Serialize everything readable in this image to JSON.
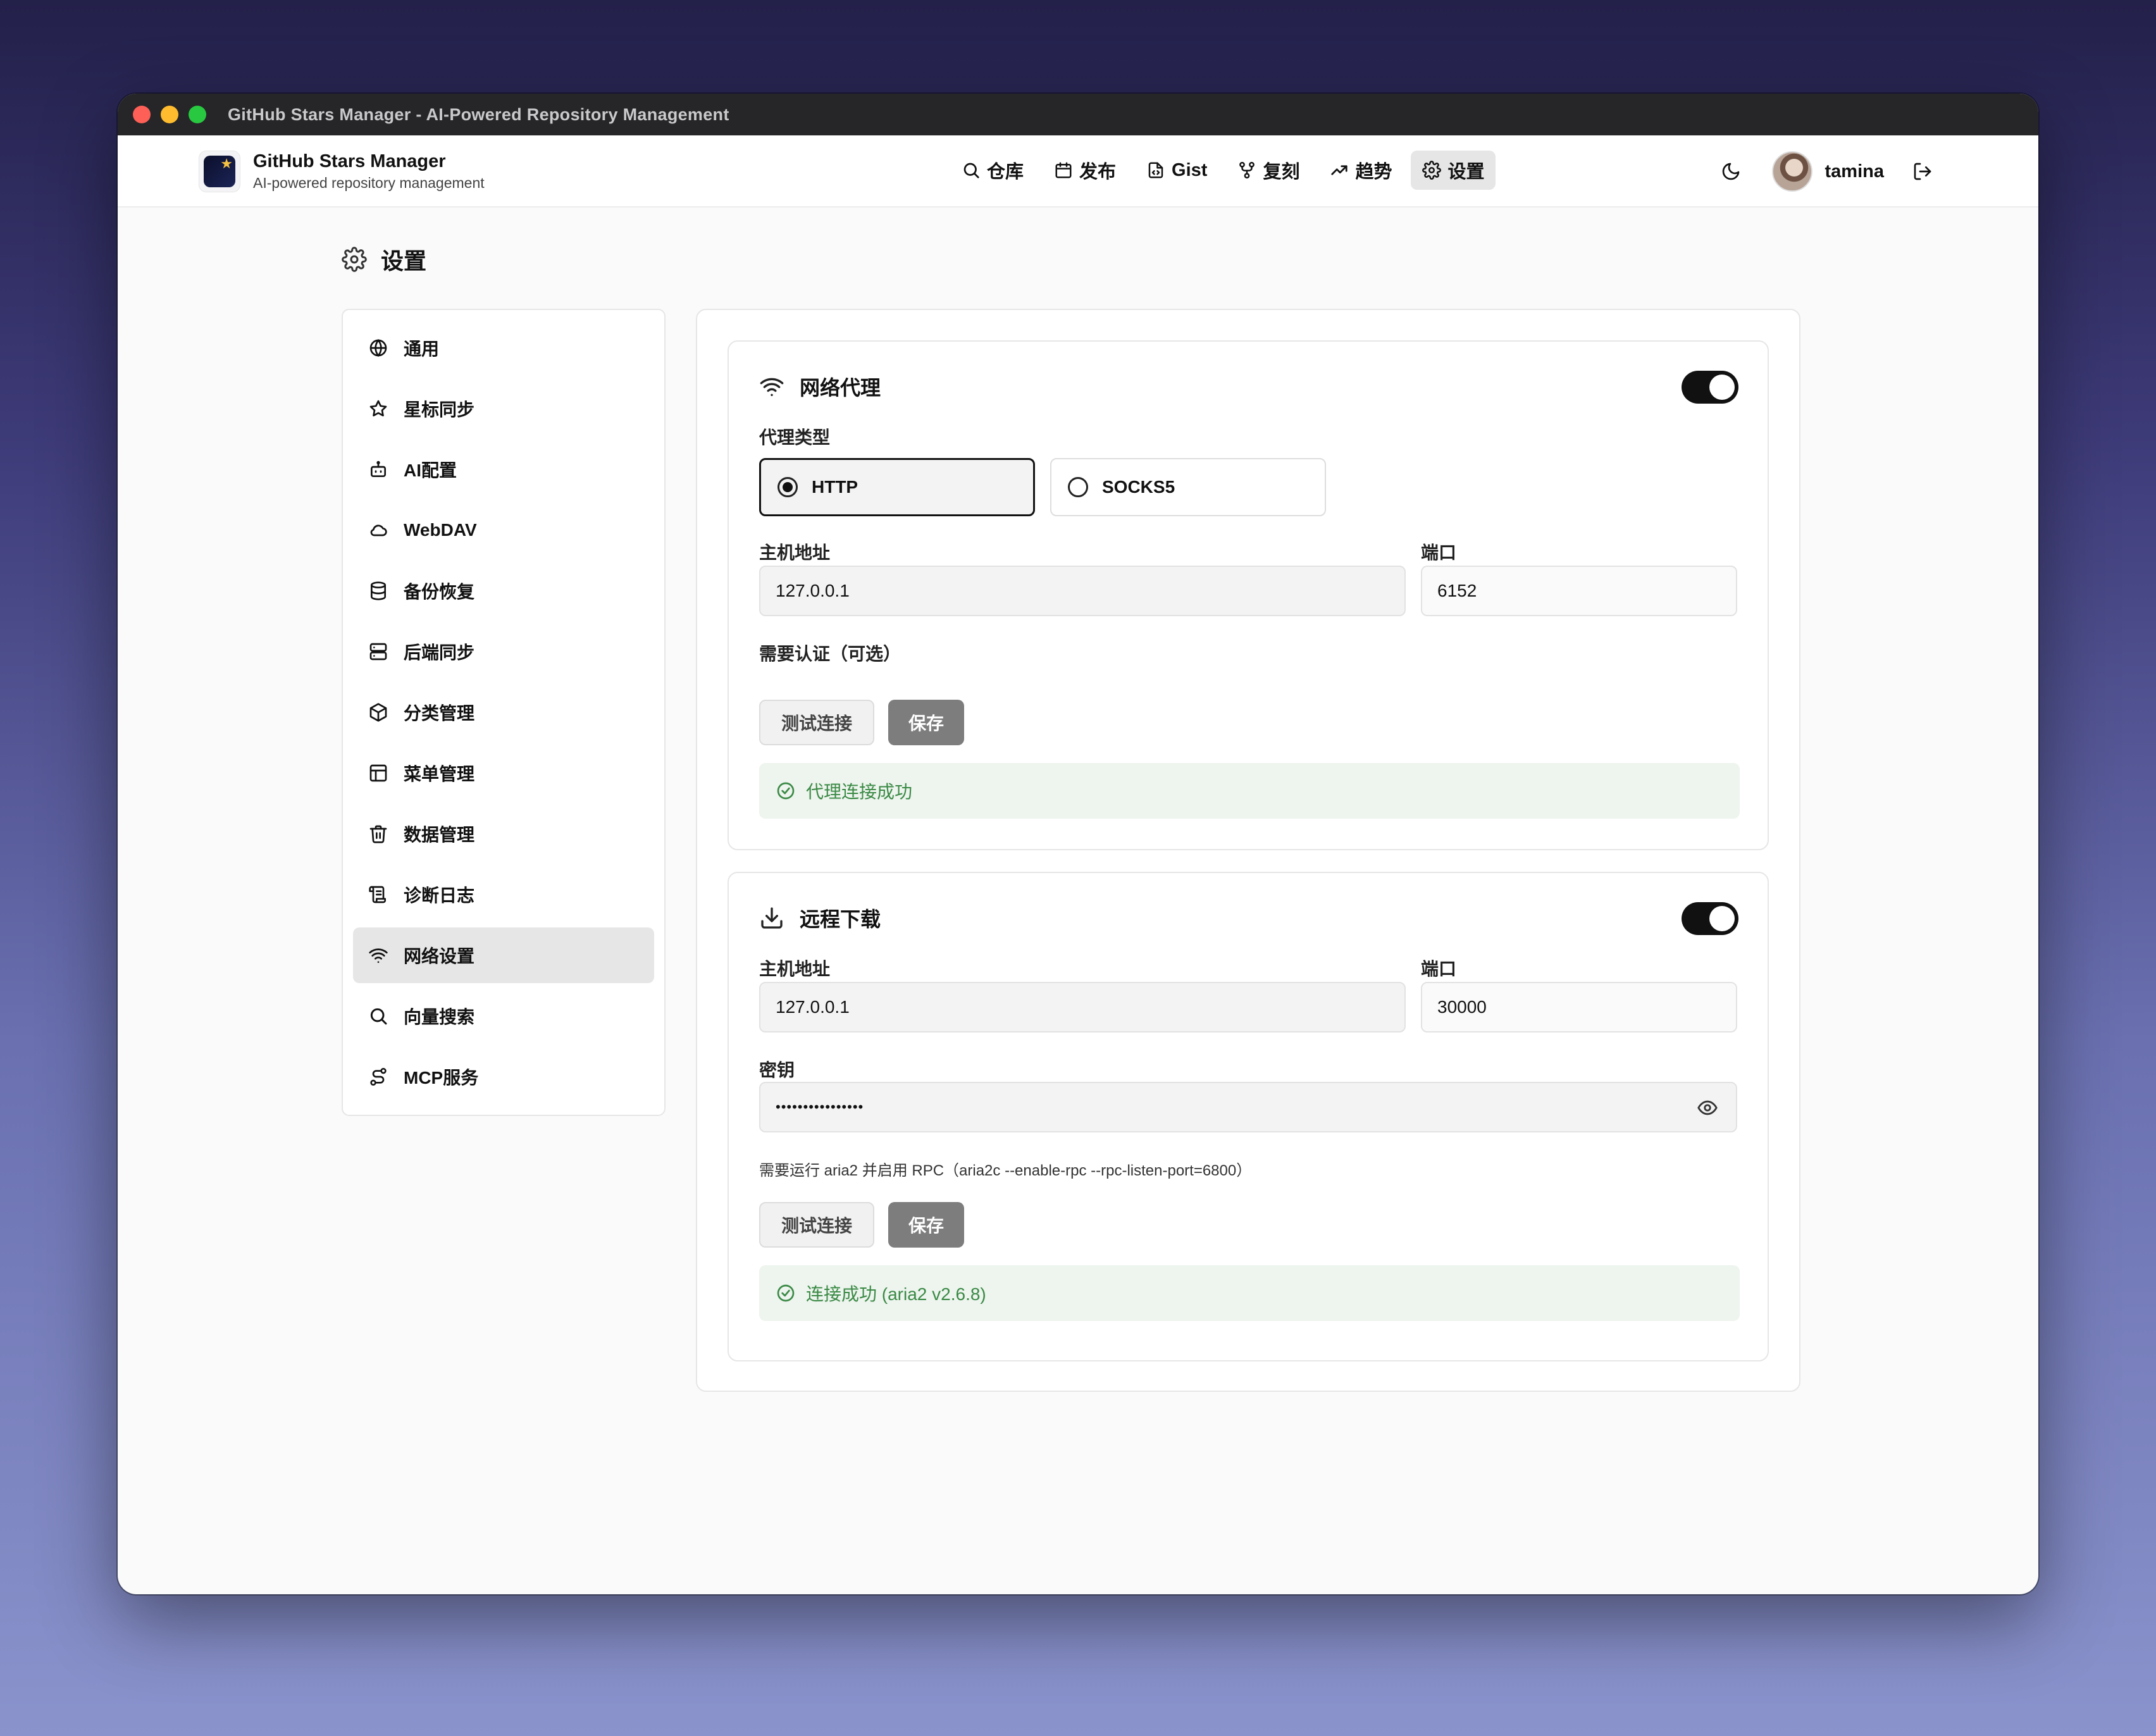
{
  "window": {
    "title": "GitHub Stars Manager - AI-Powered Repository Management"
  },
  "brand": {
    "title": "GitHub Stars Manager",
    "subtitle": "AI-powered repository management"
  },
  "nav": {
    "items": [
      {
        "label": "仓库",
        "icon": "search-icon"
      },
      {
        "label": "发布",
        "icon": "calendar-icon"
      },
      {
        "label": "Gist",
        "icon": "file-code-icon"
      },
      {
        "label": "复刻",
        "icon": "fork-icon"
      },
      {
        "label": "趋势",
        "icon": "trending-icon"
      },
      {
        "label": "设置",
        "icon": "gear-icon",
        "active": true
      }
    ],
    "username": "tamina"
  },
  "page": {
    "title": "设置"
  },
  "sidebar": {
    "items": [
      {
        "label": "通用",
        "icon": "globe-icon"
      },
      {
        "label": "星标同步",
        "icon": "star-icon"
      },
      {
        "label": "AI配置",
        "icon": "bot-icon"
      },
      {
        "label": "WebDAV",
        "icon": "cloud-icon"
      },
      {
        "label": "备份恢复",
        "icon": "database-icon"
      },
      {
        "label": "后端同步",
        "icon": "server-icon"
      },
      {
        "label": "分类管理",
        "icon": "package-icon"
      },
      {
        "label": "菜单管理",
        "icon": "layout-icon"
      },
      {
        "label": "数据管理",
        "icon": "trash-icon"
      },
      {
        "label": "诊断日志",
        "icon": "scroll-icon"
      },
      {
        "label": "网络设置",
        "icon": "wifi-icon",
        "active": true
      },
      {
        "label": "向量搜索",
        "icon": "search-icon"
      },
      {
        "label": "MCP服务",
        "icon": "route-icon"
      }
    ]
  },
  "proxy": {
    "title": "网络代理",
    "enabled": true,
    "type_label": "代理类型",
    "types": [
      "HTTP",
      "SOCKS5"
    ],
    "selected_type": "HTTP",
    "host_label": "主机地址",
    "host_value": "127.0.0.1",
    "port_label": "端口",
    "port_value": "6152",
    "auth_label": "需要认证（可选）",
    "test_button": "测试连接",
    "save_button": "保存",
    "status": "代理连接成功"
  },
  "download": {
    "title": "远程下载",
    "enabled": true,
    "host_label": "主机地址",
    "host_value": "127.0.0.1",
    "port_label": "端口",
    "port_value": "30000",
    "secret_label": "密钥",
    "secret_value": "••••••••••••••••",
    "hint": "需要运行 aria2 并启用 RPC（aria2c --enable-rpc --rpc-listen-port=6800）",
    "test_button": "测试连接",
    "save_button": "保存",
    "status": "连接成功 (aria2 v2.6.8)"
  },
  "colors": {
    "success": "#3a8a45",
    "success_bg": "#eef4ee",
    "toggle_on": "#111111"
  }
}
